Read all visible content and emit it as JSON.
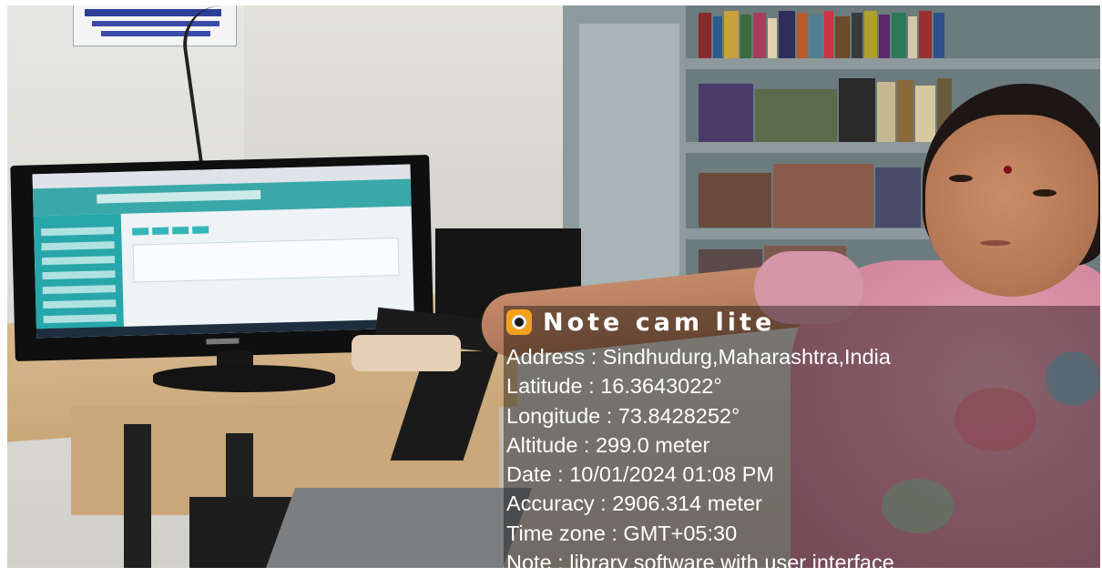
{
  "overlay": {
    "app_name": "Note cam lite",
    "icon": "camera-icon",
    "accent_color": "#f6a11a",
    "lines": [
      "Address : Sindhudurg,Maharashtra,India",
      "Latitude : 16.3643022°",
      "Longitude : 73.8428252°",
      "Altitude : 299.0 meter",
      "Date : 10/01/2024 01:08 PM",
      "Accuracy : 2906.314 meter",
      "Time zone : GMT+05:30",
      "Note : library software with user interface"
    ]
  }
}
